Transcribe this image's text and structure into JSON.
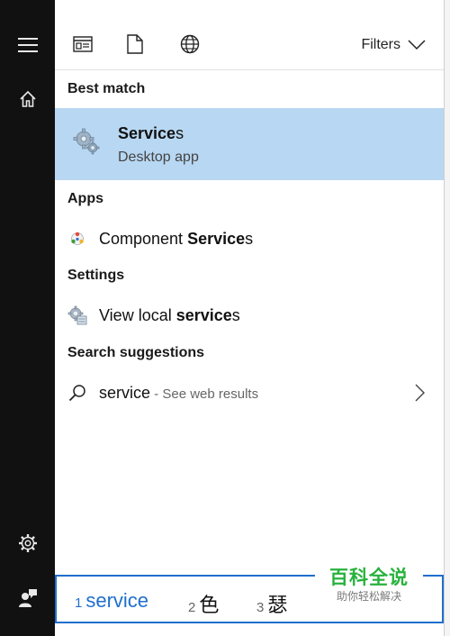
{
  "toolbar": {
    "icons": [
      "app-window-icon",
      "document-icon",
      "globe-icon"
    ],
    "filters_label": "Filters"
  },
  "sections": {
    "best_match": "Best match",
    "apps": "Apps",
    "settings": "Settings",
    "search_suggestions": "Search suggestions"
  },
  "best_match": {
    "title_bold": "Service",
    "title_rest": "s",
    "subtitle": "Desktop app",
    "icon": "gears-icon"
  },
  "apps": [
    {
      "prefix": "Component ",
      "bold": "Service",
      "suffix": "s",
      "icon": "component-services-icon"
    }
  ],
  "settings": [
    {
      "prefix": "View local ",
      "bold": "service",
      "suffix": "s",
      "icon": "local-services-icon"
    }
  ],
  "suggestions": [
    {
      "query": "service",
      "note": " - See web results",
      "icon": "search-icon"
    }
  ],
  "rail": {
    "icons": [
      "hamburger-menu-icon",
      "home-icon",
      "settings-gear-icon",
      "user-feedback-icon"
    ]
  },
  "ime": {
    "candidates": [
      {
        "num": "1",
        "text": "service"
      },
      {
        "num": "2",
        "text": "色"
      },
      {
        "num": "3",
        "text": "瑟"
      }
    ]
  },
  "watermark": {
    "big": "百科全说",
    "small": "助你轻松解决"
  },
  "colors": {
    "accent": "#1f6fce",
    "selection": "#b8d7f2",
    "rail": "#111111",
    "watermark": "#27b23c"
  }
}
